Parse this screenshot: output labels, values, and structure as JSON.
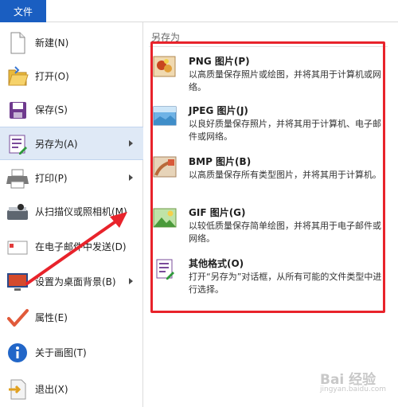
{
  "menu": {
    "file_tab": "文件",
    "items": [
      {
        "label": "新建(N)",
        "icon": "new-document-icon"
      },
      {
        "label": "打开(O)",
        "icon": "open-folder-icon"
      },
      {
        "label": "保存(S)",
        "icon": "save-disk-icon"
      },
      {
        "label": "另存为(A)",
        "icon": "save-as-icon",
        "has_submenu": true,
        "active": true
      },
      {
        "label": "打印(P)",
        "icon": "printer-icon",
        "has_submenu": true
      },
      {
        "label": "从扫描仪或照相机(M)",
        "icon": "scanner-icon"
      },
      {
        "label": "在电子邮件中发送(D)",
        "icon": "email-icon"
      },
      {
        "label": "设置为桌面背景(B)",
        "icon": "desktop-background-icon",
        "has_submenu": true
      },
      {
        "label": "属性(E)",
        "icon": "checkmark-icon"
      },
      {
        "label": "关于画图(T)",
        "icon": "info-icon"
      },
      {
        "label": "退出(X)",
        "icon": "exit-icon"
      }
    ]
  },
  "save_as_panel": {
    "title": "另存为",
    "options": [
      {
        "title": "PNG 图片(P)",
        "desc": "以高质量保存照片或绘图，并将其用于计算机或网络。",
        "icon": "png-image-icon"
      },
      {
        "title": "JPEG 图片(J)",
        "desc": "以良好质量保存照片，并将其用于计算机、电子邮件或网络。",
        "icon": "jpeg-image-icon"
      },
      {
        "title": "BMP 图片(B)",
        "desc": "以高质量保存所有类型图片，并将其用于计算机。",
        "icon": "bmp-image-icon"
      },
      {
        "title": "GIF 图片(G)",
        "desc": "以较低质量保存简单绘图，并将其用于电子邮件或网络。",
        "icon": "gif-image-icon"
      },
      {
        "title": "其他格式(O)",
        "desc": "打开“另存为”对话框，从所有可能的文件类型中进行选择。",
        "icon": "other-formats-icon"
      }
    ]
  },
  "annotation": {
    "highlight_color": "#e8232b"
  },
  "watermark": {
    "text": "Bai 经验",
    "sub": "jingyan.baidu.com"
  },
  "colors": {
    "file_tab_bg": "#1a5ec1",
    "active_item_bg": "#dfe9f6"
  }
}
